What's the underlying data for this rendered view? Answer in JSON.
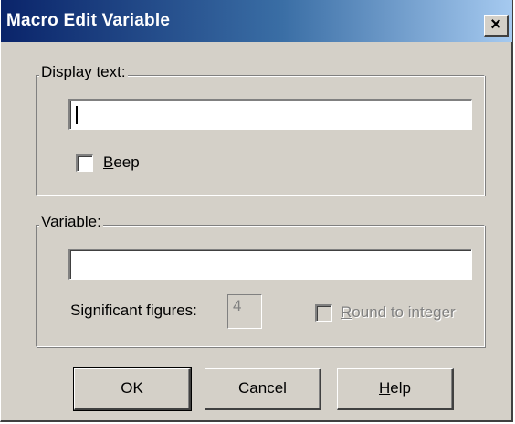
{
  "window": {
    "title": "Macro Edit Variable",
    "close_glyph": "×"
  },
  "display_group": {
    "legend": "Display text:",
    "text_value": "",
    "beep_label": "Beep",
    "beep_checked": false
  },
  "variable_group": {
    "legend": "Variable:",
    "variable_value": "",
    "sig_figs_label": "Significant figures:",
    "sig_figs_value": "4",
    "round_label": "Round to integer",
    "round_checked": false
  },
  "buttons": {
    "ok": "OK",
    "cancel": "Cancel",
    "help": "Help"
  },
  "colors": {
    "face": "#d4d0c8",
    "title_start": "#0a246a",
    "title_end": "#a6caf0",
    "disabled_text": "#808080"
  }
}
